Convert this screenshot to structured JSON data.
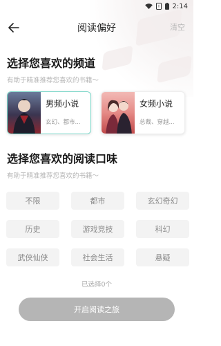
{
  "status_bar": {
    "time": "2:14"
  },
  "header": {
    "title": "阅读偏好",
    "clear_label": "清空"
  },
  "channel_section": {
    "title": "选择您喜欢的频道",
    "subtitle": "有助于精准推荐您喜欢的书籍～",
    "channels": [
      {
        "name": "男频小说",
        "desc": "玄幻、都市...",
        "selected": true
      },
      {
        "name": "女频小说",
        "desc": "总裁、穿越...",
        "selected": false
      }
    ]
  },
  "taste_section": {
    "title": "选择您喜欢的阅读口味",
    "subtitle": "有助于精准推荐您喜欢的书籍～",
    "tags": [
      "不限",
      "都市",
      "玄幻奇幻",
      "历史",
      "游戏竞技",
      "科幻",
      "武侠仙侠",
      "社会生活",
      "悬疑"
    ],
    "selected_count_text": "已选择0个"
  },
  "start_button": {
    "label": "开启阅读之旅"
  },
  "colors": {
    "selected_border": "#7ad6c8",
    "tag_bg": "#f3f3f3",
    "button_bg": "#b5b5b5"
  }
}
